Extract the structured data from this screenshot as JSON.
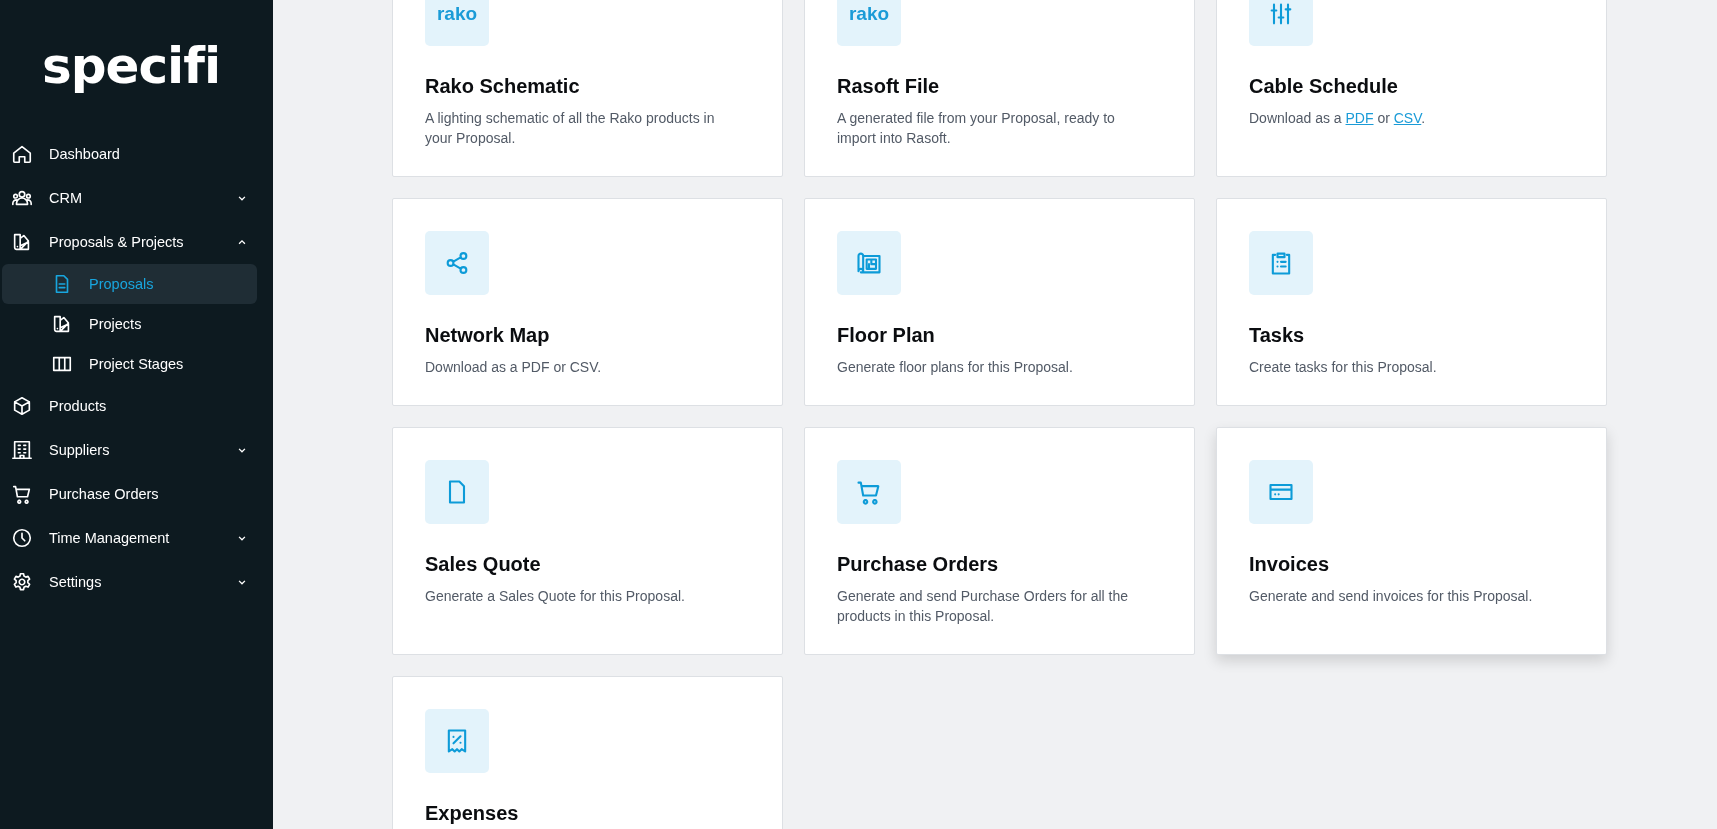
{
  "sidebar": {
    "logo": "specifi",
    "items": [
      {
        "label": "Dashboard"
      },
      {
        "label": "CRM",
        "expanded": false
      },
      {
        "label": "Proposals & Projects",
        "expanded": true,
        "children": [
          {
            "label": "Proposals",
            "selected": true
          },
          {
            "label": "Projects",
            "selected": false
          },
          {
            "label": "Project Stages",
            "selected": false
          }
        ]
      },
      {
        "label": "Products"
      },
      {
        "label": "Suppliers",
        "expanded": false
      },
      {
        "label": "Purchase Orders"
      },
      {
        "label": "Time Management",
        "expanded": false
      },
      {
        "label": "Settings",
        "expanded": false
      }
    ]
  },
  "cards": [
    {
      "title": "Rako Schematic",
      "logo_text": "rako",
      "highlighted": false,
      "description": [
        {
          "kind": "text",
          "text": "A lighting schematic of all the Rako products in your Proposal."
        }
      ]
    },
    {
      "title": "Rasoft File",
      "logo_text": "rako",
      "highlighted": false,
      "description": [
        {
          "kind": "text",
          "text": "A generated file from your Proposal, ready to import into Rasoft."
        }
      ]
    },
    {
      "title": "Cable Schedule",
      "highlighted": false,
      "description": [
        {
          "kind": "text",
          "text": "Download as a "
        },
        {
          "kind": "link",
          "text": "PDF"
        },
        {
          "kind": "text",
          "text": " or "
        },
        {
          "kind": "link",
          "text": "CSV"
        },
        {
          "kind": "text",
          "text": "."
        }
      ]
    },
    {
      "title": "Network Map",
      "highlighted": false,
      "description": [
        {
          "kind": "text",
          "text": "Download as a PDF or CSV."
        }
      ]
    },
    {
      "title": "Floor Plan",
      "highlighted": false,
      "description": [
        {
          "kind": "text",
          "text": "Generate floor plans for this Proposal."
        }
      ]
    },
    {
      "title": "Tasks",
      "highlighted": false,
      "description": [
        {
          "kind": "text",
          "text": "Create tasks for this Proposal."
        }
      ]
    },
    {
      "title": "Sales Quote",
      "highlighted": false,
      "description": [
        {
          "kind": "text",
          "text": "Generate a Sales Quote for this Proposal."
        }
      ]
    },
    {
      "title": "Purchase Orders",
      "highlighted": false,
      "description": [
        {
          "kind": "text",
          "text": "Generate and send Purchase Orders for all the products in this Proposal."
        }
      ]
    },
    {
      "title": "Invoices",
      "highlighted": true,
      "description": [
        {
          "kind": "text",
          "text": "Generate and send invoices for this Proposal."
        }
      ]
    },
    {
      "title": "Expenses",
      "highlighted": false
    }
  ]
}
